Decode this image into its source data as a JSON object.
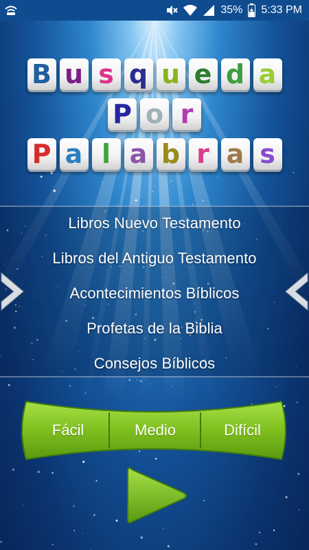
{
  "status_bar": {
    "battery": "35%",
    "time": "5:33 PM",
    "left_icons": [
      "wifi-hotspot-icon"
    ],
    "right_icons": [
      "mute-icon",
      "wifi-icon",
      "signal-icon",
      "battery-icon"
    ]
  },
  "title": {
    "rows": [
      [
        {
          "ch": "B",
          "color": "#1f5f9e"
        },
        {
          "ch": "u",
          "color": "#7a1f86"
        },
        {
          "ch": "s",
          "color": "#e0338a"
        },
        {
          "ch": "q",
          "color": "#2b2c8f"
        },
        {
          "ch": "u",
          "color": "#8bb320"
        },
        {
          "ch": "e",
          "color": "#2e7d32"
        },
        {
          "ch": "d",
          "color": "#3e9e3e"
        },
        {
          "ch": "a",
          "color": "#9acd32"
        }
      ],
      [
        {
          "ch": "P",
          "color": "#2626a0"
        },
        {
          "ch": "o",
          "color": "#9fb0b8"
        },
        {
          "ch": "r",
          "color": "#b03cb0"
        }
      ],
      [
        {
          "ch": "P",
          "color": "#d62b2b"
        },
        {
          "ch": "a",
          "color": "#2c7fc0"
        },
        {
          "ch": "l",
          "color": "#3fa33a"
        },
        {
          "ch": "a",
          "color": "#8b55a8"
        },
        {
          "ch": "b",
          "color": "#9a8a1a"
        },
        {
          "ch": "r",
          "color": "#d83d8a"
        },
        {
          "ch": "a",
          "color": "#9d7a4a"
        },
        {
          "ch": "s",
          "color": "#8a4ad0"
        }
      ]
    ]
  },
  "menu": {
    "items": [
      "Libros Nuevo Testamento",
      "Libros del Antiguo Testamento",
      "Acontecimientos Bíblicos",
      "Profetas de la Biblia",
      "Consejos Bíblicos"
    ]
  },
  "difficulty": {
    "options": [
      "Fácil",
      "Medio",
      "Difícil"
    ]
  },
  "colors": {
    "accent_green": "#7fbf1e",
    "background_blue": "#15549a"
  }
}
